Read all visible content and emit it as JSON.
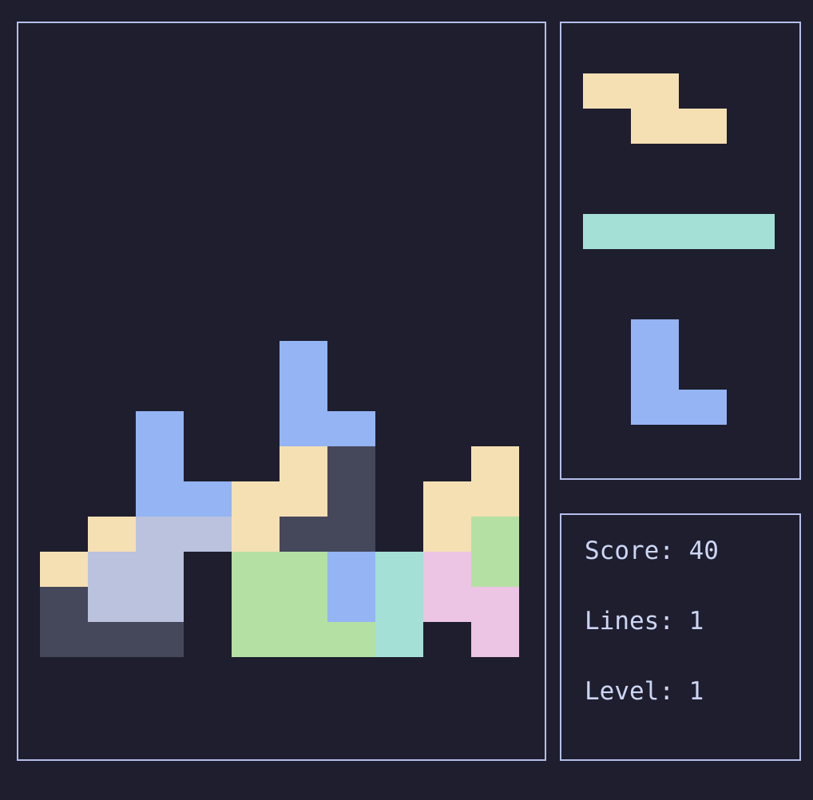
{
  "colors": {
    "background": "#1e1e2e",
    "border": "#b4bee9",
    "text": "#cdd6f4",
    "yellow": "#f5e0b4",
    "blue": "#94b4f4",
    "dark": "#45475a",
    "lavender": "#bac2de",
    "green": "#b4e0a4",
    "teal": "#a4e0d6",
    "pink": "#ecc4e4"
  },
  "board": {
    "cols": 11,
    "rows": 20,
    "cells": [
      [
        "............"
      ],
      [
        "..........."
      ]
    ],
    "grid": [
      "...........",
      "...........",
      "...........",
      "...........",
      "...........",
      "...........",
      "...........",
      "...........",
      "...........",
      "...........",
      "...........",
      ".....B.....",
      ".....B.....",
      "..B..BB....",
      "..B..YD..Y.",
      "..BBYYD.YY.",
      ".YLLYDD.YG.",
      "YLL.GGBTPG.",
      "DLL.GGBTPP.",
      "DDD.GGGT.P."
    ]
  },
  "next_pieces": [
    {
      "name": "Z",
      "color": "yellow",
      "shape": [
        "YY.",
        ".YY"
      ]
    },
    {
      "name": "I",
      "color": "teal",
      "shape": [
        "TTTT"
      ]
    },
    {
      "name": "L",
      "color": "blue",
      "shape": [
        "B.",
        "B.",
        "BB"
      ]
    }
  ],
  "stats": {
    "score_label": "Score: 40",
    "lines_label": "Lines: 1",
    "level_label": "Level: 1"
  }
}
